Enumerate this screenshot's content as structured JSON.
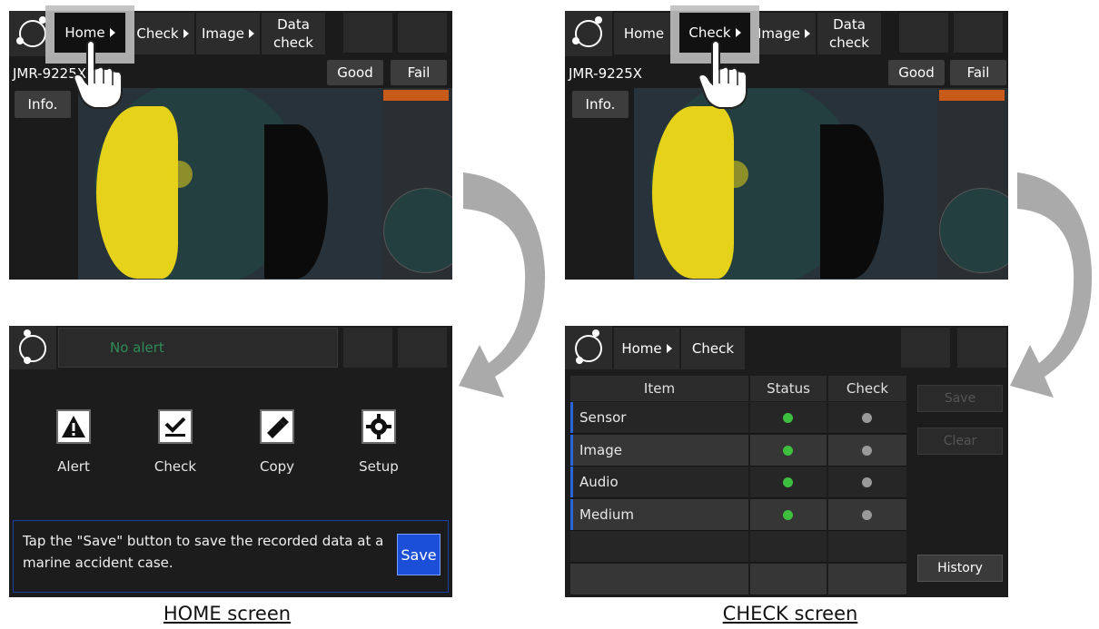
{
  "left_top": {
    "tabs": [
      "Home",
      "Check",
      "Image",
      "Data\ncheck"
    ],
    "model": "JMR-9225X",
    "info_label": "Info.",
    "good_label": "Good",
    "fail_label": "Fail"
  },
  "right_top": {
    "tabs": [
      "Home",
      "Check",
      "Image",
      "Data\ncheck"
    ],
    "model": "JMR-9225X",
    "info_label": "Info.",
    "good_label": "Good",
    "fail_label": "Fail"
  },
  "home_screen": {
    "alert_text": "No alert",
    "icons": [
      {
        "label": "Alert",
        "icon": "alert-triangle-icon"
      },
      {
        "label": "Check",
        "icon": "checkmark-icon"
      },
      {
        "label": "Copy",
        "icon": "usb-drive-icon"
      },
      {
        "label": "Setup",
        "icon": "gear-icon"
      }
    ],
    "message": "Tap the \"Save\" button to save the recorded data at a marine accident case.",
    "save_label": "Save"
  },
  "check_screen": {
    "breadcrumb": [
      "Home",
      "Check"
    ],
    "headers": [
      "Item",
      "Status",
      "Check"
    ],
    "rows": [
      {
        "item": "Sensor",
        "status": "green",
        "check": "gray"
      },
      {
        "item": "Image",
        "status": "green",
        "check": "gray"
      },
      {
        "item": "Audio",
        "status": "green",
        "check": "gray"
      },
      {
        "item": "Medium",
        "status": "green",
        "check": "gray"
      },
      {
        "item": "",
        "status": "",
        "check": ""
      },
      {
        "item": "",
        "status": "",
        "check": ""
      }
    ],
    "save_label": "Save",
    "clear_label": "Clear",
    "history_label": "History"
  },
  "captions": {
    "home": "HOME screen",
    "check": "CHECK screen"
  },
  "colors": {
    "status_green": "#3fbf3f",
    "check_gray": "#9a9a9a",
    "save_blue": "#1b4fd8",
    "row_accent": "#2a66d8"
  }
}
